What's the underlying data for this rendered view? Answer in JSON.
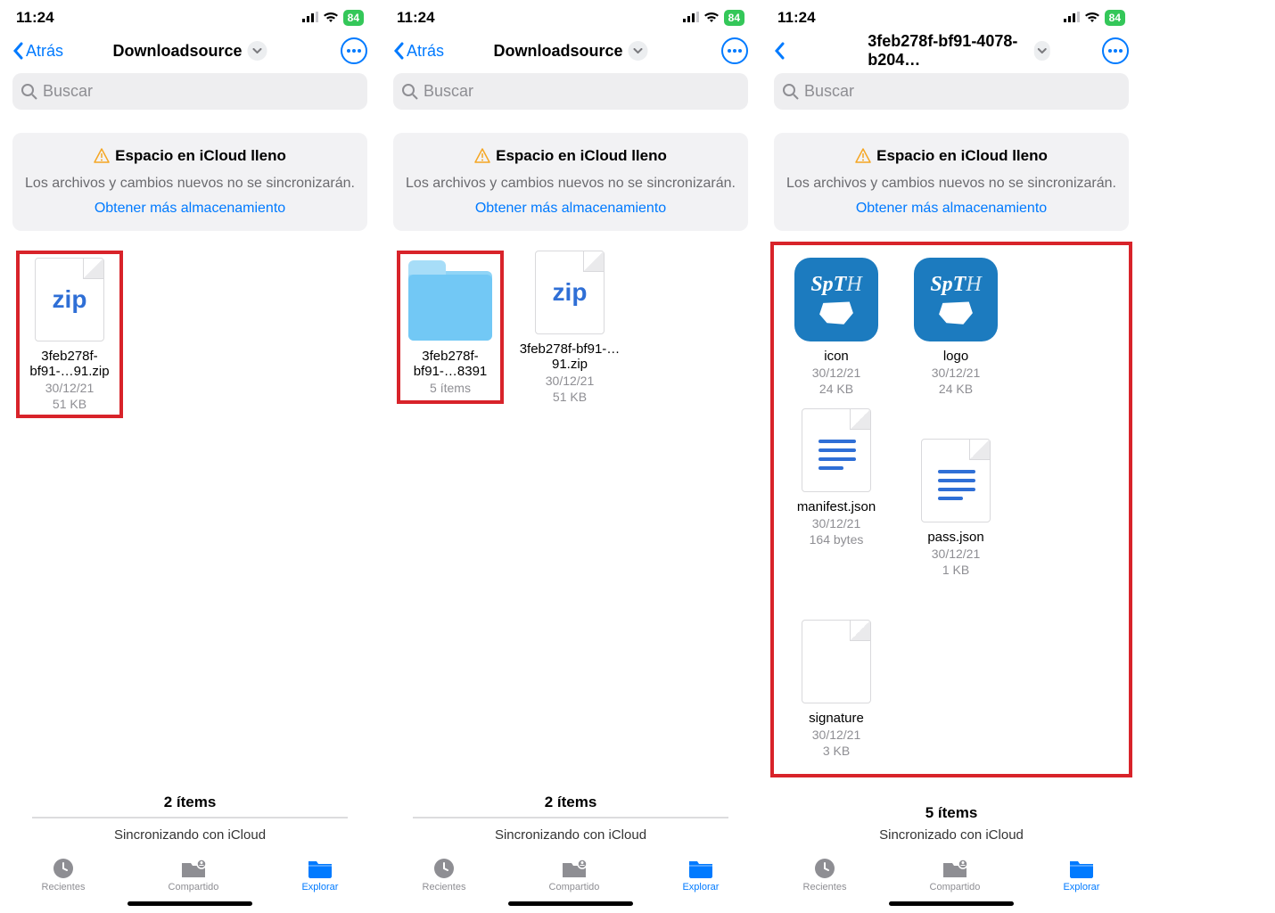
{
  "screens": [
    {
      "time": "11:24",
      "battery": "84",
      "back_label": "Atrás",
      "title": "Downloadsource",
      "search_placeholder": "Buscar",
      "alert": {
        "title": "Espacio en iCloud lleno",
        "message": "Los archivos y cambios nuevos no se sincronizarán.",
        "link": "Obtener más almacenamiento"
      },
      "items": [
        {
          "type": "zip",
          "name": "3feb278f-bf91-…91.zip",
          "date": "30/12/21",
          "size": "51 KB",
          "highlight": true
        }
      ],
      "footer_count": "2 ítems",
      "footer_sync": "Sincronizando con iCloud",
      "tabs": [
        "Recientes",
        "Compartido",
        "Explorar"
      ]
    },
    {
      "time": "11:24",
      "battery": "84",
      "back_label": "Atrás",
      "title": "Downloadsource",
      "search_placeholder": "Buscar",
      "alert": {
        "title": "Espacio en iCloud lleno",
        "message": "Los archivos y cambios nuevos no se sincronizarán.",
        "link": "Obtener más almacenamiento"
      },
      "items": [
        {
          "type": "folder",
          "name": "3feb278f-bf91-…8391",
          "meta": "5 ítems",
          "highlight": true
        },
        {
          "type": "zip",
          "name": "3feb278f-bf91-…91.zip",
          "date": "30/12/21",
          "size": "51 KB"
        }
      ],
      "footer_count": "2 ítems",
      "footer_sync": "Sincronizando con iCloud",
      "tabs": [
        "Recientes",
        "Compartido",
        "Explorar"
      ]
    },
    {
      "time": "11:24",
      "battery": "84",
      "back_label": "",
      "title": "3feb278f-bf91-4078-b204…",
      "search_placeholder": "Buscar",
      "alert": {
        "title": "Espacio en iCloud lleno",
        "message": "Los archivos y cambios nuevos no se sincronizarán.",
        "link": "Obtener más almacenamiento"
      },
      "items": [
        {
          "type": "app",
          "name": "icon",
          "date": "30/12/21",
          "size": "24 KB"
        },
        {
          "type": "app",
          "name": "logo",
          "date": "30/12/21",
          "size": "24 KB"
        },
        {
          "type": "json",
          "name": "manifest.json",
          "date": "30/12/21",
          "size": "164 bytes"
        },
        {
          "type": "json",
          "name": "pass.json",
          "date": "30/12/21",
          "size": "1 KB"
        },
        {
          "type": "json",
          "name": "signature",
          "date": "30/12/21",
          "size": "3 KB"
        }
      ],
      "group_highlight": true,
      "footer_count": "5 ítems",
      "footer_sync": "Sincronizado con iCloud",
      "tabs": [
        "Recientes",
        "Compartido",
        "Explorar"
      ]
    }
  ],
  "zip_label": "zip"
}
